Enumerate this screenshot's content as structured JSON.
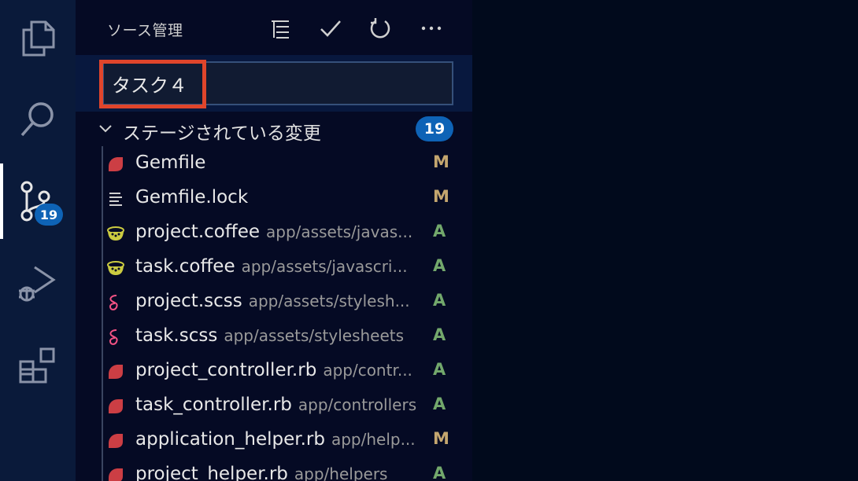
{
  "activity_bar": {
    "items": [
      {
        "name": "explorer",
        "icon": "files-icon"
      },
      {
        "name": "search",
        "icon": "search-icon"
      },
      {
        "name": "source-control",
        "icon": "source-control-icon",
        "badge": "19",
        "active": true
      },
      {
        "name": "run-debug",
        "icon": "run-debug-icon"
      },
      {
        "name": "extensions",
        "icon": "extensions-icon"
      }
    ]
  },
  "panel": {
    "title": "ソース管理",
    "actions": [
      "view-as-tree-icon",
      "commit-check-icon",
      "refresh-icon",
      "more-actions-icon"
    ]
  },
  "commit": {
    "message": "タスク４"
  },
  "staged_group": {
    "label": "ステージされている変更",
    "count": "19"
  },
  "files": [
    {
      "name": "Gemfile",
      "path": "",
      "status": "M",
      "icon": "ruby-icon"
    },
    {
      "name": "Gemfile.lock",
      "path": "",
      "status": "M",
      "icon": "lines-icon"
    },
    {
      "name": "project.coffee",
      "path": "app/assets/javas...",
      "status": "A",
      "icon": "coffee-icon"
    },
    {
      "name": "task.coffee",
      "path": "app/assets/javascri...",
      "status": "A",
      "icon": "coffee-icon"
    },
    {
      "name": "project.scss",
      "path": "app/assets/stylesh...",
      "status": "A",
      "icon": "sass-icon"
    },
    {
      "name": "task.scss",
      "path": "app/assets/stylesheets",
      "status": "A",
      "icon": "sass-icon"
    },
    {
      "name": "project_controller.rb",
      "path": "app/contr...",
      "status": "A",
      "icon": "ruby-icon"
    },
    {
      "name": "task_controller.rb",
      "path": "app/controllers",
      "status": "A",
      "icon": "ruby-icon"
    },
    {
      "name": "application_helper.rb",
      "path": "app/help...",
      "status": "M",
      "icon": "ruby-icon"
    },
    {
      "name": "project_helper.rb",
      "path": "app/helpers",
      "status": "A",
      "icon": "ruby-icon"
    }
  ],
  "colors": {
    "accent": "#0e63b6",
    "highlight": "#e0452b",
    "modified": "#c4a66f",
    "added": "#73a86c"
  }
}
